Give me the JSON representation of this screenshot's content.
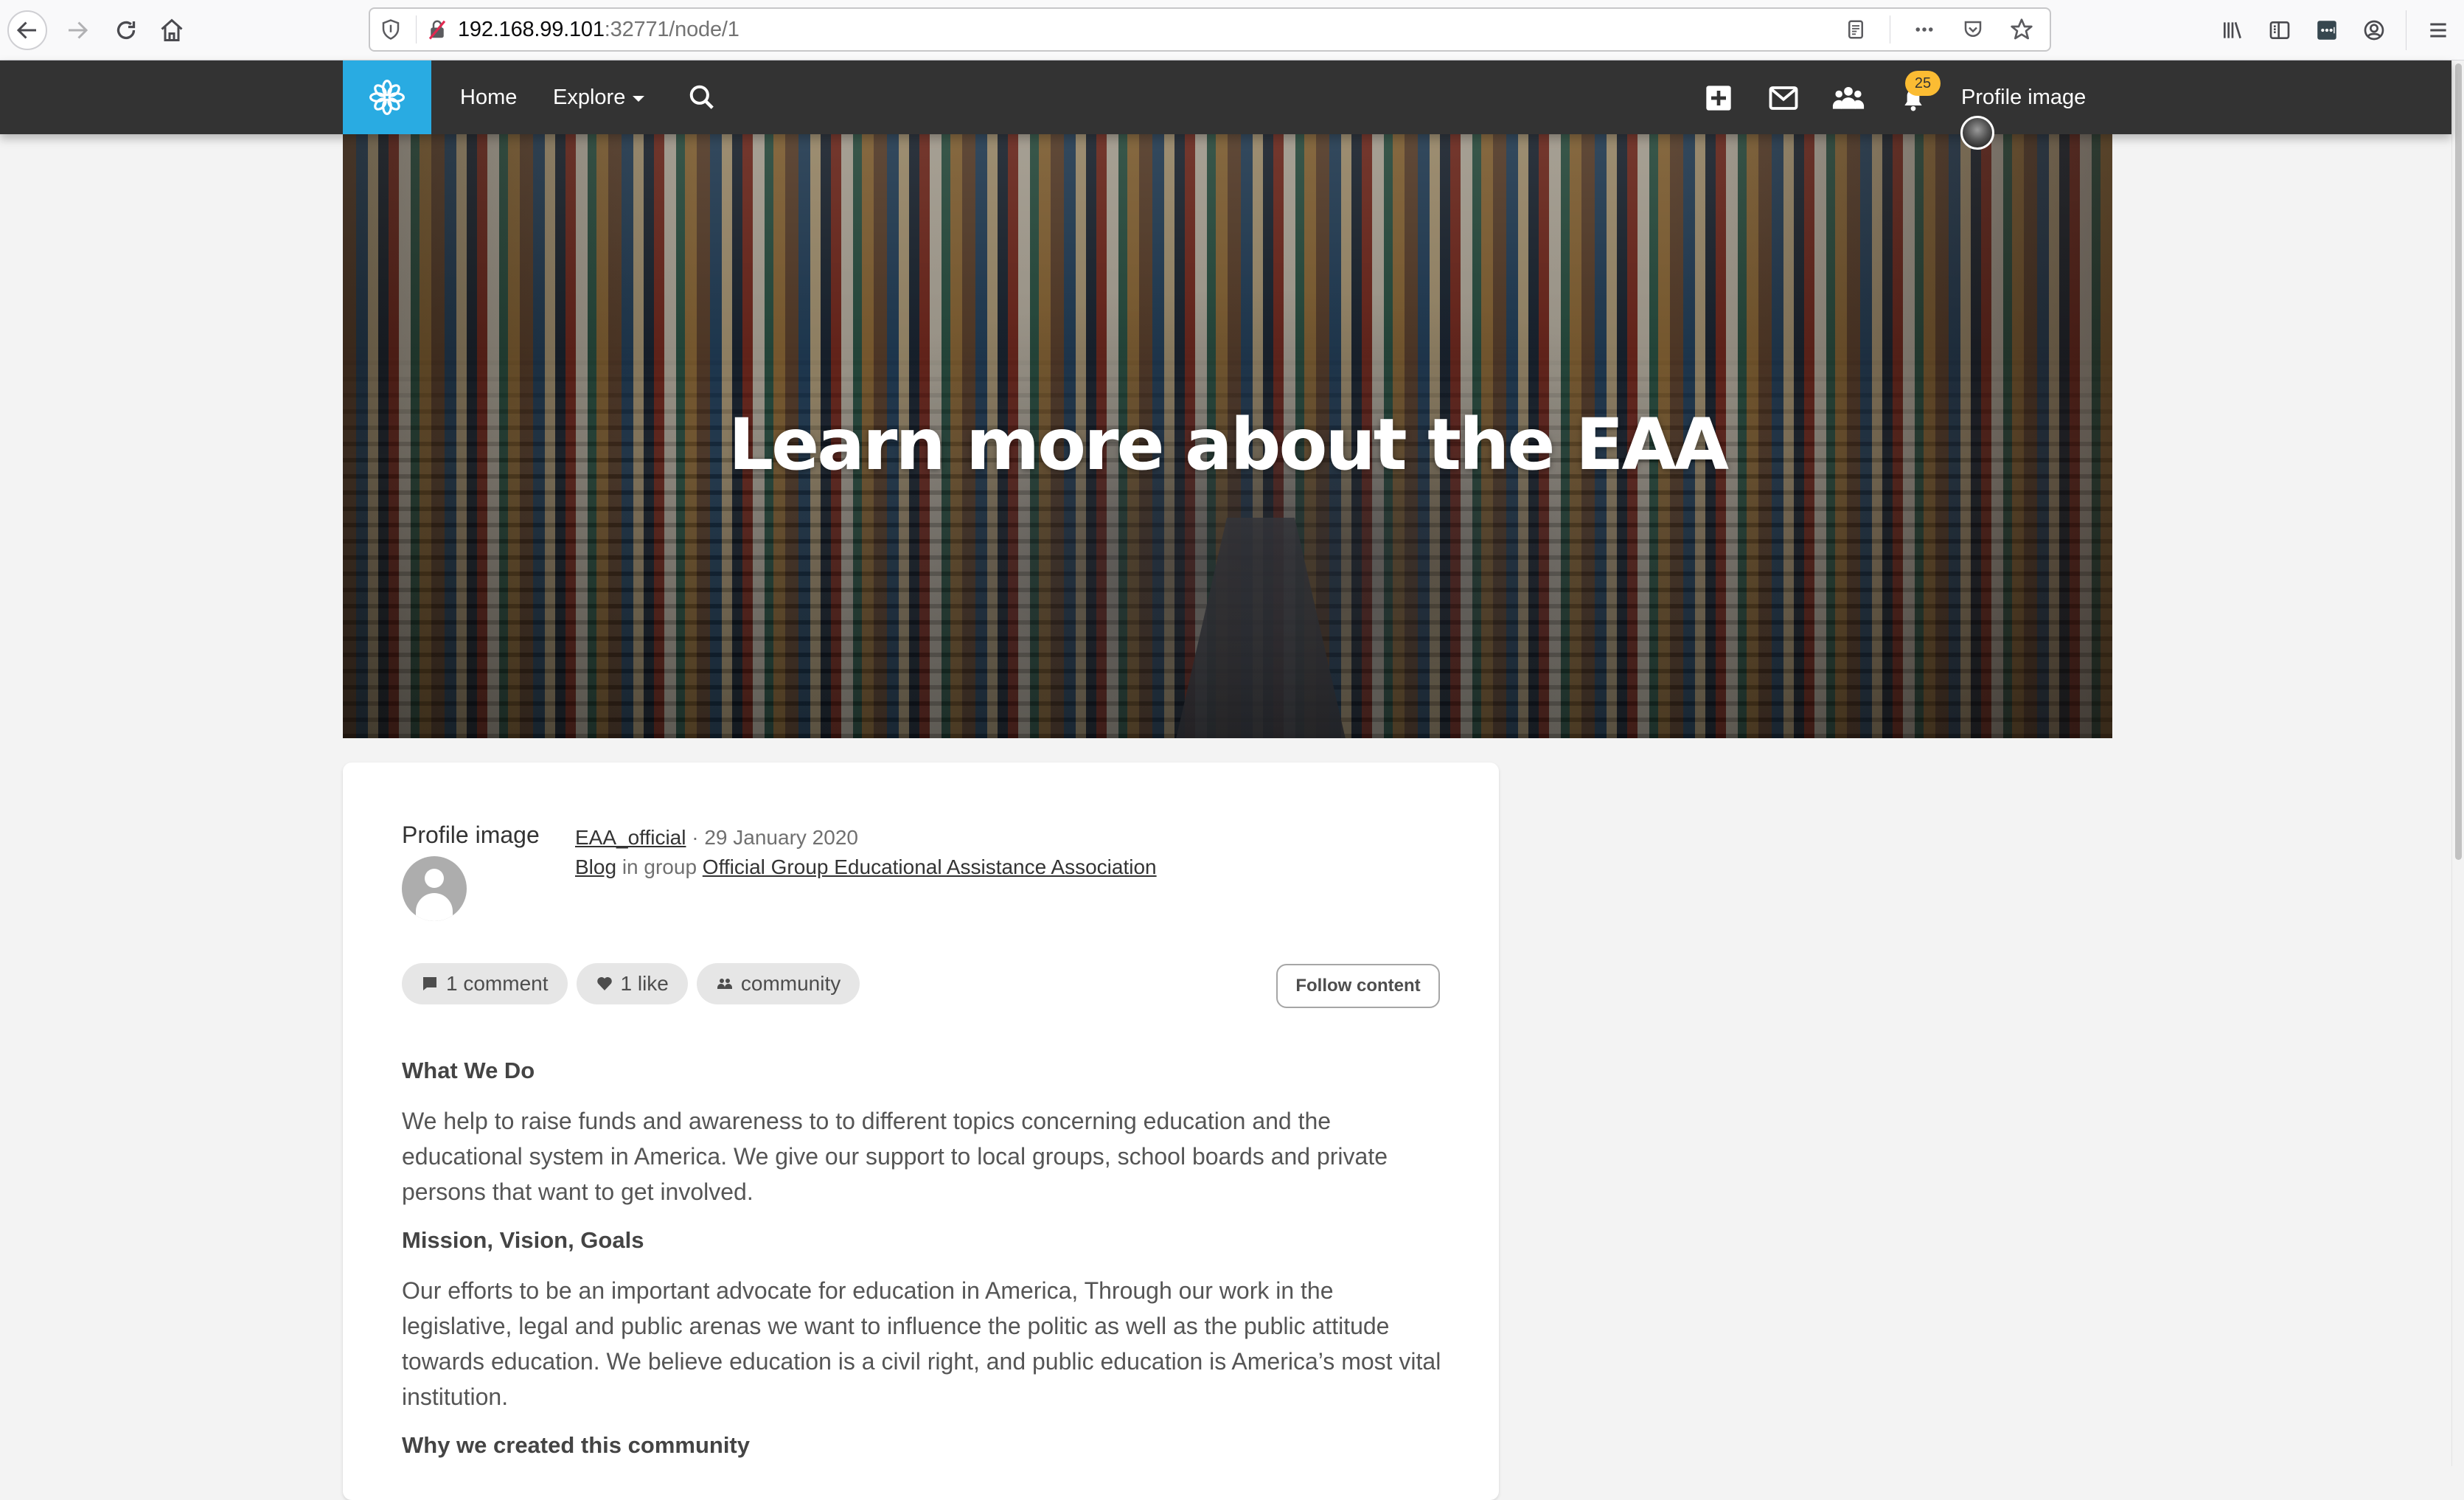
{
  "browser": {
    "url_host": "192.168.99.101",
    "url_path": ":32771/node/1",
    "icons": {
      "back": "arrow-left-icon",
      "forward": "arrow-right-icon",
      "reload": "reload-icon",
      "home": "home-icon",
      "tracking": "shield-icon",
      "insecure": "insecure-lock-icon",
      "reader": "reader-view-icon",
      "more": "more-dots-icon",
      "pocket": "pocket-icon",
      "bookmark": "star-icon",
      "library": "library-icon",
      "sidebar": "sidebar-icon",
      "extension": "extension-icon",
      "account": "account-icon",
      "menu": "hamburger-menu-icon"
    }
  },
  "nav": {
    "logo": "flower-logo-icon",
    "home_label": "Home",
    "explore_label": "Explore",
    "search": "search-icon",
    "add": "add-content-icon",
    "mail": "mail-icon",
    "groups": "groups-icon",
    "notifications": "bell-icon",
    "notification_count": "25",
    "profile_label": "Profile image",
    "colors": {
      "bar": "#333333",
      "logo_bg": "#29abe2",
      "badge": "#fbbc33"
    }
  },
  "hero": {
    "title": "Learn more about the EAA"
  },
  "post": {
    "author_label": "Profile image",
    "author_name": "EAA_official",
    "separator": " · ",
    "date": "29 January 2020",
    "type_label": "Blog",
    "in_group_text": " in group ",
    "group_name": "Official Group Educational Assistance Association",
    "pills": [
      {
        "icon": "comment-icon",
        "label": "1 comment"
      },
      {
        "icon": "heart-icon",
        "label": "1 like"
      },
      {
        "icon": "community-icon",
        "label": "community"
      }
    ],
    "follow_label": "Follow content",
    "sections": [
      {
        "heading": "What We Do",
        "text": "We help to raise funds and awareness to to different topics concerning education and the educational system in America. We give our support to local groups, school boards and private persons that want to get involved."
      },
      {
        "heading": "Mission, Vision, Goals",
        "text": "Our efforts to be an important advocate for education in America, Through our work in the legislative, legal and public arenas we want to influence the politic as well as the public attitude towards education. We believe education is a civil right, and public education is America’s most vital institution."
      },
      {
        "heading": "Why we created this community",
        "text": ""
      }
    ]
  }
}
